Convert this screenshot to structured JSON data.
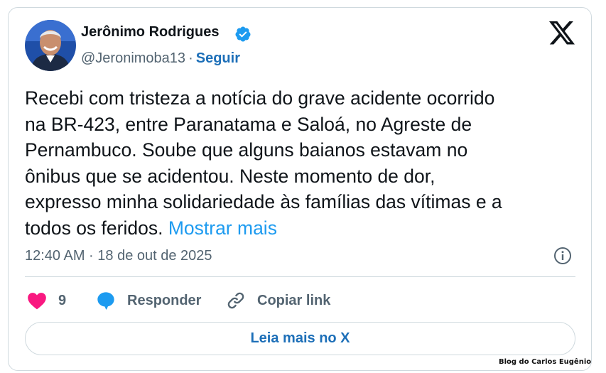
{
  "author": {
    "name": "Jerônimo Rodrigues",
    "handle": "@Jeronimoba13",
    "separator": "·",
    "follow_label": "Seguir",
    "verified": true
  },
  "tweet": {
    "text": "Recebi com  tristeza a notícia do grave acidente ocorrido\nna BR-423, entre Paranatama e Saloá, no Agreste de\nPernambuco. Soube que alguns baianos estavam no\nônibus que se acidentou. Neste momento de dor,\nexpresso minha solidariedade às famílias das vítimas e a\ntodos os feridos. ",
    "show_more_label": "Mostrar mais",
    "timestamp": "12:40 AM · 18 de out de 2025"
  },
  "actions": {
    "like_count": "9",
    "reply_label": "Responder",
    "copy_label": "Copiar link"
  },
  "read_more_label": "Leia mais no X",
  "watermark": "Blog do Carlos Eugênio",
  "icons": {
    "logo": "x-logo-icon",
    "verified": "verified-badge-icon",
    "info": "info-icon",
    "like": "heart-icon",
    "reply": "speech-bubble-icon",
    "copy": "link-icon"
  },
  "colors": {
    "accent": "#1d9bf0",
    "link_dark": "#1d6fb8",
    "heart": "#f91880",
    "secondary_text": "#536471",
    "border": "#cfd9de"
  }
}
